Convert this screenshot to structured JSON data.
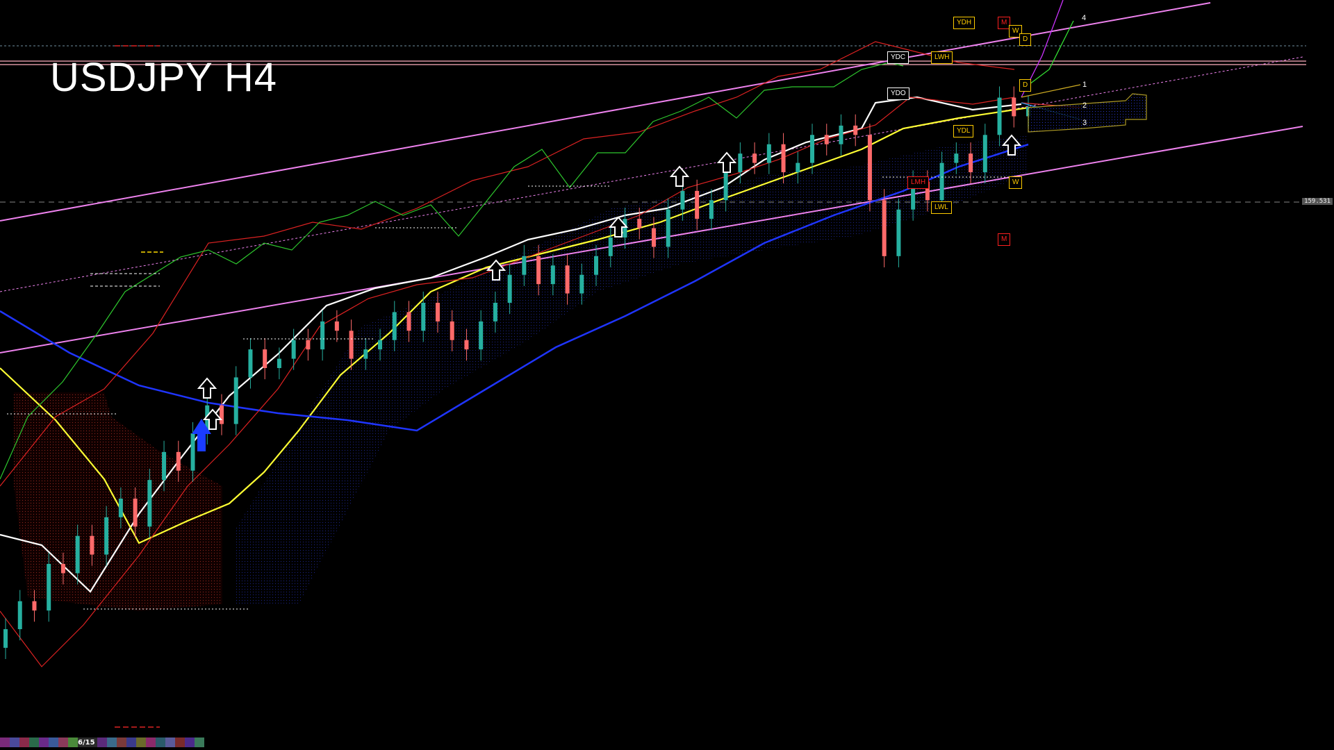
{
  "chart_data": {
    "type": "candlestick",
    "symbol": "USDJPY",
    "timeframe": "H4",
    "title": "USDJPY H4",
    "date_marker": "6/15",
    "price_tags": [
      "",
      "159.531"
    ],
    "ylim": [
      154.2,
      161.2
    ],
    "closes": [
      154.9,
      155.2,
      155.1,
      155.6,
      155.5,
      155.9,
      155.7,
      156.1,
      156.3,
      156.0,
      156.5,
      156.8,
      156.6,
      157.0,
      157.3,
      157.1,
      157.6,
      157.9,
      157.7,
      157.8,
      158.0,
      157.9,
      158.2,
      158.1,
      157.8,
      157.9,
      158.0,
      158.3,
      158.1,
      158.4,
      158.2,
      158.0,
      157.9,
      158.2,
      158.4,
      158.7,
      158.9,
      158.6,
      158.8,
      158.5,
      158.7,
      158.9,
      159.1,
      159.3,
      159.2,
      159.0,
      159.4,
      159.6,
      159.3,
      159.5,
      159.8,
      160.0,
      159.9,
      160.1,
      159.8,
      159.9,
      160.2,
      160.1,
      160.3,
      160.2,
      159.5,
      158.9,
      159.4,
      159.7,
      159.5,
      159.9,
      160.0,
      159.8,
      160.2,
      160.6,
      160.4,
      160.5
    ],
    "series": [
      {
        "name": "",
        "color": "#ffffff"
      },
      {
        "name": "",
        "color": "#ffff00"
      },
      {
        "name": "",
        "color": "#1f35ff"
      },
      {
        "name": "",
        "color": "#ee82ee"
      }
    ],
    "levels": [
      {
        "label": "YDH",
        "color": "#ffcc00"
      },
      {
        "label": "M",
        "color": "#ff2020"
      },
      {
        "label": "W",
        "color": "#ffcc00"
      },
      {
        "label": "D",
        "color": "#ffcc00"
      },
      {
        "label": "YDC",
        "color": "#ffffff"
      },
      {
        "label": "LWH",
        "color": "#ffcc00"
      },
      {
        "label": "YDO",
        "color": "#ffffff"
      },
      {
        "label": "D",
        "color": "#ffcc00"
      },
      {
        "label": "YDL",
        "color": "#ffcc00"
      },
      {
        "label": "LMH",
        "color": "#ff2020"
      },
      {
        "label": "W",
        "color": "#ffcc00"
      },
      {
        "label": "LWL",
        "color": "#ffcc00"
      },
      {
        "label": "M",
        "color": "#ff2020"
      }
    ],
    "fib_labels": [
      "4",
      "1",
      "2",
      "3"
    ],
    "arrow_count": 7
  },
  "colors": {
    "bull": "#26b0a0",
    "bear": "#ff6a6a",
    "cloud_blue": "#2233cc",
    "cloud_red": "#cc3322"
  }
}
